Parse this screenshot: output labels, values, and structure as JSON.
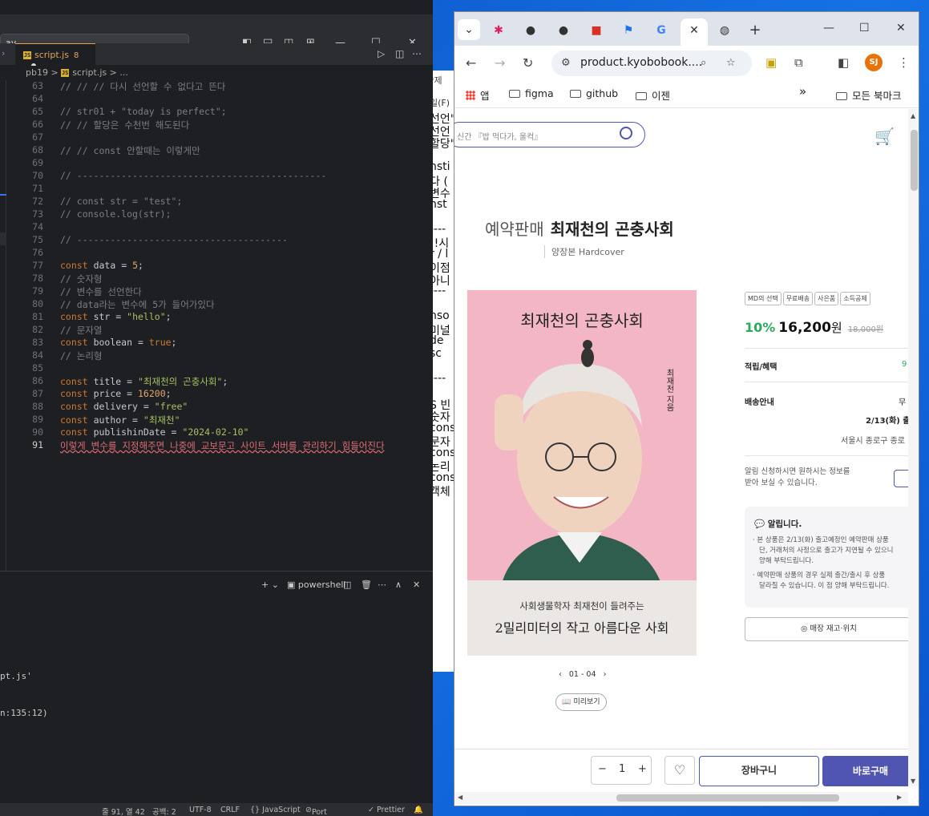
{
  "vscode": {
    "search_text": "ay",
    "tab": {
      "filename": "script.js",
      "problems": "8"
    },
    "breadcrumb": {
      "folder": "pb19",
      "sep1": ">",
      "file": "script.js",
      "sep2": "> ..."
    },
    "code": {
      "l63": {
        "n": "63",
        "t": "// // // 다시 선언할 수 없다고 뜬다"
      },
      "l64": {
        "n": "64"
      },
      "l65": {
        "n": "65",
        "t": "// str01 + \"today is perfect\";"
      },
      "l66": {
        "n": "66",
        "t": "// // 할당은 수천번 해도된다"
      },
      "l67": {
        "n": "67"
      },
      "l68": {
        "n": "68",
        "t": "// // const 안할때는 이렇게만"
      },
      "l69": {
        "n": "69"
      },
      "l70": {
        "n": "70",
        "t": "// ---------------------------------------------"
      },
      "l71": {
        "n": "71"
      },
      "l72": {
        "n": "72",
        "t": "// const str = \"test\";"
      },
      "l73": {
        "n": "73",
        "t": "// console.log(str);"
      },
      "l74": {
        "n": "74"
      },
      "l75": {
        "n": "75",
        "t": "// --------------------------------------"
      },
      "l76": {
        "n": "76"
      },
      "l77": {
        "n": "77",
        "kw": "const",
        "id": "data",
        "eq": "=",
        "v": "5",
        "end": ";"
      },
      "l78": {
        "n": "78",
        "t": "// 숫자형"
      },
      "l79": {
        "n": "79",
        "t": "// 변수를 선언한다"
      },
      "l80": {
        "n": "80",
        "t": "// data라는 변수에 5가 들어가있다"
      },
      "l81": {
        "n": "81",
        "kw": "const",
        "id": "str",
        "eq": "=",
        "v": "\"hello\"",
        "end": ";"
      },
      "l82": {
        "n": "82",
        "t": "// 문자열"
      },
      "l83": {
        "n": "83",
        "kw": "const",
        "id": "boolean",
        "eq": "=",
        "v": "true",
        "end": ";"
      },
      "l84": {
        "n": "84",
        "t": "// 논리형"
      },
      "l85": {
        "n": "85"
      },
      "l86": {
        "n": "86",
        "kw": "const",
        "id": "title",
        "eq": "=",
        "v": "\"최재천의 곤충사회\"",
        "end": ";"
      },
      "l87": {
        "n": "87",
        "kw": "const",
        "id": "price",
        "eq": "=",
        "v": "16200",
        "end": ";"
      },
      "l88": {
        "n": "88",
        "kw": "const",
        "id": "delivery",
        "eq": "=",
        "v": "\"free\""
      },
      "l89": {
        "n": "89",
        "kw": "const",
        "id": "author",
        "eq": "=",
        "v": "\"최재천\""
      },
      "l90": {
        "n": "90",
        "kw": "const",
        "id": "publishinDate",
        "eq": "=",
        "v": "\"2024-02-10\""
      },
      "l91": {
        "n": "91",
        "t": "이렇게 변수를 지정해주면 나중에 교보문고 사이트 서버를 관리하기 힘들어진다"
      }
    },
    "panel": {
      "shell": "powershell",
      "line1": "pt.js'",
      "line2": "n:135:12)"
    },
    "status": {
      "position": "줄 91, 열 42",
      "spaces": "공백: 2",
      "encoding": "UTF-8",
      "eol": "CRLF",
      "language": "{} JavaScript",
      "port": "Port : 5500",
      "prettier": "✓ Prettier"
    }
  },
  "notepad": {
    "lines": [
      "선언\"",
      "선언",
      "할당\"",
      "",
      "nsti",
      "다 (",
      "변수",
      "nst",
      "",
      "----",
      "!!시",
      "r / l",
      "이점",
      "아니",
      "----",
      "",
      "nso",
      "미널",
      "de",
      "sc",
      "",
      "----",
      "",
      "S 빈",
      "숫자",
      "cons",
      "문자",
      "cons",
      "논리",
      "cons",
      "객체"
    ],
    "menu": "일(F)",
    "title": "*제"
  },
  "chrome": {
    "url": "product.kyobobook....",
    "avatar": "SJ",
    "bookmarks": {
      "apps": "앱",
      "b1": "figma",
      "b2": "github",
      "b3": "이젠",
      "more": "»",
      "all": "모든 북마크"
    },
    "page": {
      "search_placeholder": "신간 『밥 먹다가, 울컥』",
      "presale": "예약판매",
      "title": "최재천의 곤충사회",
      "subtitle": "양장본 Hardcover",
      "cover": {
        "title": "최재천의 곤충사회",
        "author": "최재천 지음",
        "tagline": "사회생물학자 최재천이 들려주는",
        "main": "2밀리미터의 작고 아름다운 사회"
      },
      "pager": "01 - 04",
      "preview": "미리보기",
      "badges": [
        "MD의 선택",
        "무료배송",
        "사은품",
        "소득공제"
      ],
      "discount": "10%",
      "price": "16,200",
      "won": "원",
      "orig_price": "18,000원",
      "points_label": "적립/혜택",
      "points_val": "9",
      "delivery_label": "배송안내",
      "delivery_val": "무",
      "delivery_date": "2/13(화) 출",
      "delivery_addr": "서울시 종로구 종로",
      "alarm_line1": "알림 신청하시면 원하시는 정보를",
      "alarm_line2": "받아 보실 수 있습니다.",
      "notice_title": "알립니다.",
      "notice_1a": "본 상품은 2/13(화) 출고예정인 예약판매 상품",
      "notice_1b": "단, 거래처의 사정으로 출고가 지연될 수 있으니",
      "notice_1c": "양해 부탁드립니다.",
      "notice_2a": "예약판매 상품의 경우 실제 출간/출시 후 상품",
      "notice_2b": "달라질 수 있습니다. 이 점 양해 부탁드립니다.",
      "store_btn": "매장 재고·위치",
      "qty": "1",
      "cart_btn": "장바구니",
      "buy_btn": "바로구매"
    }
  }
}
